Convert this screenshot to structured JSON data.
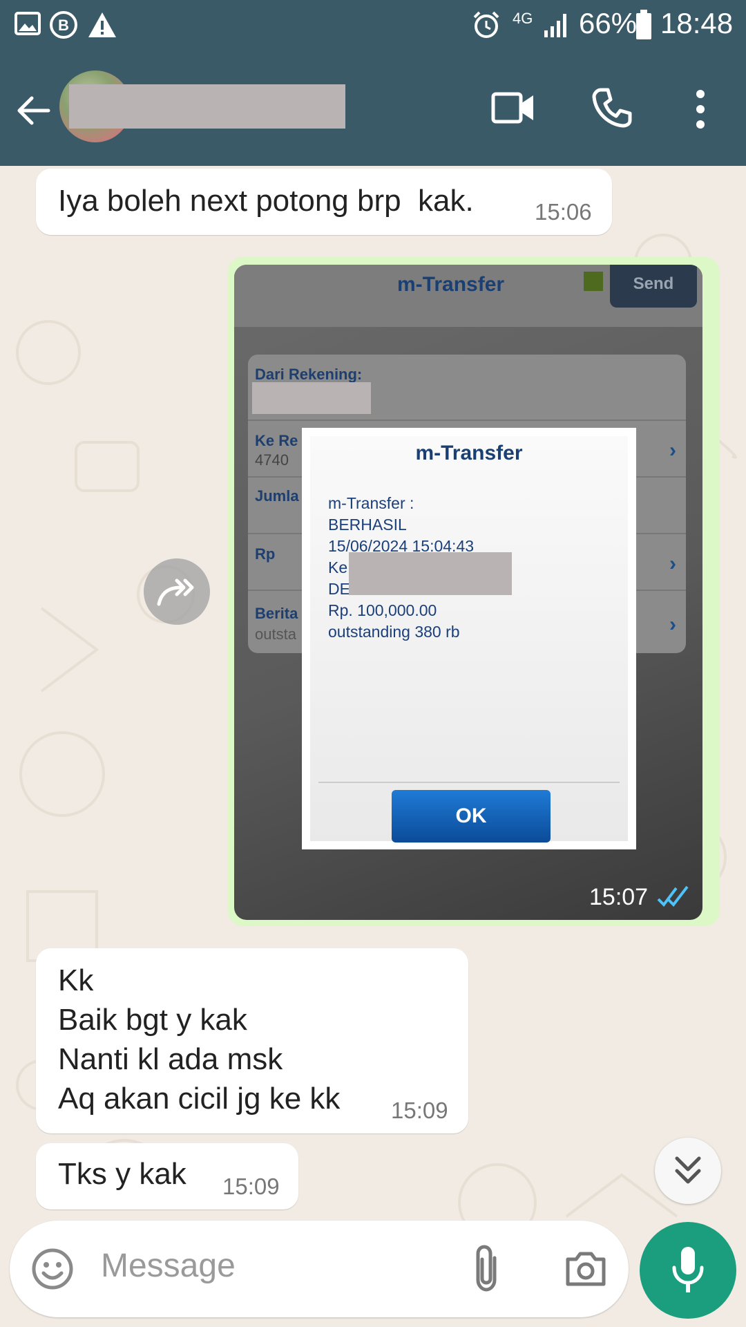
{
  "status_bar": {
    "battery": "66%",
    "time": "18:48",
    "network": "4G",
    "icons": [
      "gallery-icon",
      "b-badge-icon",
      "warning-icon",
      "alarm-icon",
      "signal-icon",
      "battery-icon"
    ]
  },
  "header": {
    "contact_name_redacted": true,
    "icons": [
      "back-arrow-icon",
      "video-call-icon",
      "phone-icon",
      "more-vert-icon"
    ]
  },
  "messages": [
    {
      "text": "Iya boleh next potong brp  kak.",
      "time": "15:06"
    },
    {
      "text": "Kk\nBaik bgt y kak\nNanti kl ada msk\nAq akan cicil jg ke kk",
      "time": "15:09"
    },
    {
      "text": "Tks y kak",
      "time": "15:09"
    }
  ],
  "image_message": {
    "time": "15:07",
    "screenshot": {
      "title": "m-Transfer",
      "send_button": "Send",
      "rows": [
        "Dari Rekening:",
        "Ke Re",
        "4740",
        "Jumla",
        "Rp",
        "Berita",
        "outsta"
      ],
      "dialog": {
        "title": "m-Transfer",
        "lines": [
          "m-Transfer :",
          "BERHASIL",
          "15/06/2024 15:04:43",
          "Ke 4",
          "DE",
          "Rp. 100,000.00",
          "outstanding 380 rb"
        ],
        "ok_label": "OK"
      }
    }
  },
  "input": {
    "placeholder": "Message"
  },
  "colors": {
    "header": "#3b5a68",
    "chat_bg": "#f1ebe3",
    "outgoing": "#dcf8c6",
    "accent": "#1a9e7e",
    "ticks": "#4fc3f7"
  }
}
